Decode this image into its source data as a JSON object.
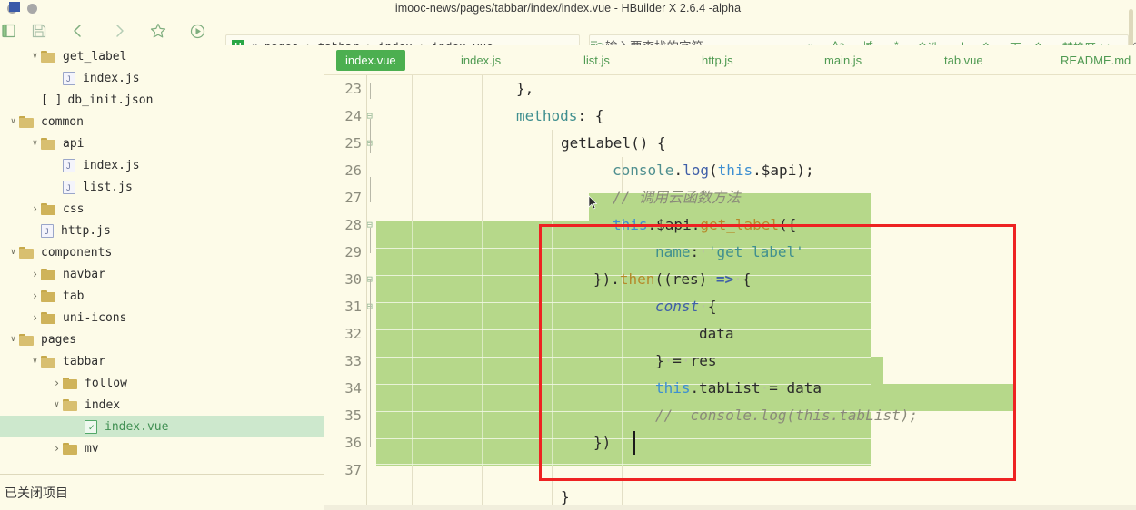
{
  "window": {
    "title": "imooc-news/pages/tabbar/index/index.vue - HBuilder X 2.6.4 -alpha"
  },
  "toolbar": {
    "icons": [
      {
        "name": "panel-icon",
        "glyph": "☲"
      },
      {
        "name": "save-icon",
        "glyph": "ὋE"
      },
      {
        "name": "back-icon",
        "glyph": "‹"
      },
      {
        "name": "forward-icon",
        "glyph": "›"
      },
      {
        "name": "star-icon",
        "glyph": "☆"
      },
      {
        "name": "run-icon",
        "glyph": "▶"
      }
    ]
  },
  "breadcrumb": {
    "logo": "U",
    "guillemet": "«",
    "segments": [
      "pages",
      "tabbar",
      "index",
      "index.vue"
    ],
    "separator": "›"
  },
  "search": {
    "placeholder": "输入要查找的字符",
    "value": "",
    "chevron": "∨",
    "buttons": [
      {
        "name": "match-case-button",
        "label": "Aa"
      },
      {
        "name": "whole-word-button",
        "label": "域"
      },
      {
        "name": "regex-button",
        "label": ".*"
      },
      {
        "name": "select-all-button",
        "label": "全选"
      },
      {
        "name": "previous-button",
        "label": "上一个"
      },
      {
        "name": "next-button",
        "label": "下一个"
      },
      {
        "name": "replace-panel-button",
        "label": "替换区<<"
      }
    ],
    "close": "✕"
  },
  "sidebar": {
    "tree": [
      {
        "indent": 1,
        "arrow": "v",
        "type": "folder-open",
        "label": "get_label",
        "selected": false
      },
      {
        "indent": 2,
        "arrow": "",
        "type": "js",
        "label": "index.js",
        "selected": false
      },
      {
        "indent": 1,
        "arrow": "",
        "type": "json",
        "label": "db_init.json",
        "selected": false
      },
      {
        "indent": 0,
        "arrow": "v",
        "type": "folder-open",
        "label": "common",
        "selected": false
      },
      {
        "indent": 1,
        "arrow": "v",
        "type": "folder-open",
        "label": "api",
        "selected": false
      },
      {
        "indent": 2,
        "arrow": "",
        "type": "js",
        "label": "index.js",
        "selected": false
      },
      {
        "indent": 2,
        "arrow": "",
        "type": "js",
        "label": "list.js",
        "selected": false
      },
      {
        "indent": 1,
        "arrow": ">",
        "type": "folder",
        "label": "css",
        "selected": false
      },
      {
        "indent": 1,
        "arrow": "",
        "type": "js",
        "label": "http.js",
        "selected": false
      },
      {
        "indent": 0,
        "arrow": "v",
        "type": "folder-open",
        "label": "components",
        "selected": false
      },
      {
        "indent": 1,
        "arrow": ">",
        "type": "folder",
        "label": "navbar",
        "selected": false
      },
      {
        "indent": 1,
        "arrow": ">",
        "type": "folder",
        "label": "tab",
        "selected": false
      },
      {
        "indent": 1,
        "arrow": ">",
        "type": "folder",
        "label": "uni-icons",
        "selected": false
      },
      {
        "indent": 0,
        "arrow": "v",
        "type": "folder-open",
        "label": "pages",
        "selected": false
      },
      {
        "indent": 1,
        "arrow": "v",
        "type": "folder-open",
        "label": "tabbar",
        "selected": false
      },
      {
        "indent": 2,
        "arrow": ">",
        "type": "folder",
        "label": "follow",
        "selected": false
      },
      {
        "indent": 2,
        "arrow": "v",
        "type": "folder-open",
        "label": "index",
        "selected": false
      },
      {
        "indent": 3,
        "arrow": "",
        "type": "vue",
        "label": "index.vue",
        "selected": true
      },
      {
        "indent": 2,
        "arrow": ">",
        "type": "folder",
        "label": "mv",
        "selected": false
      }
    ],
    "status": "已关闭项目"
  },
  "editor": {
    "tabs": [
      {
        "label": "index.vue",
        "active": true
      },
      {
        "label": "index.js",
        "active": false
      },
      {
        "label": "list.js",
        "active": false
      },
      {
        "label": "http.js",
        "active": false
      },
      {
        "label": "main.js",
        "active": false
      },
      {
        "label": "tab.vue",
        "active": false
      },
      {
        "label": "README.md",
        "active": false
      }
    ],
    "line_numbers": [
      "23",
      "24",
      "25",
      "26",
      "27",
      "28",
      "29",
      "30",
      "31",
      "32",
      "33",
      "34",
      "35",
      "36",
      "37"
    ],
    "fold_markers": {
      "24": "⊟",
      "25": "⊟",
      "28": "⊟",
      "30": "⊟",
      "31": "⊟"
    },
    "code_lines": [
      {
        "num": "23",
        "text": "        },"
      },
      {
        "num": "24",
        "text": "        methods: {"
      },
      {
        "num": "25",
        "text": "            getLabel() {"
      },
      {
        "num": "26",
        "text": "                console.log(this.$api);"
      },
      {
        "num": "27",
        "text": "                // 调用云函数方法"
      },
      {
        "num": "28",
        "text": "                this.$api.get_label({"
      },
      {
        "num": "29",
        "text": "                    name: 'get_label'"
      },
      {
        "num": "30",
        "text": "                }).then((res) => {"
      },
      {
        "num": "31",
        "text": "                    const {"
      },
      {
        "num": "32",
        "text": "                        data"
      },
      {
        "num": "33",
        "text": "                    } = res"
      },
      {
        "num": "34",
        "text": "                    this.tabList = data"
      },
      {
        "num": "35",
        "text": "                    // console.log(this.tabList);"
      },
      {
        "num": "36",
        "text": "                })"
      },
      {
        "num": "37",
        "text": ""
      }
    ],
    "selection_start_line": "28",
    "selection_end_line": "36",
    "annotation": {
      "name": "red-highlight-box",
      "color": "#ee2222"
    }
  },
  "colors": {
    "background": "#fdfbe8",
    "accent_green": "#4caf50",
    "selection_green": "#b6d88a",
    "tree_selection": "#cde8cd",
    "annotation_red": "#ee2222"
  }
}
